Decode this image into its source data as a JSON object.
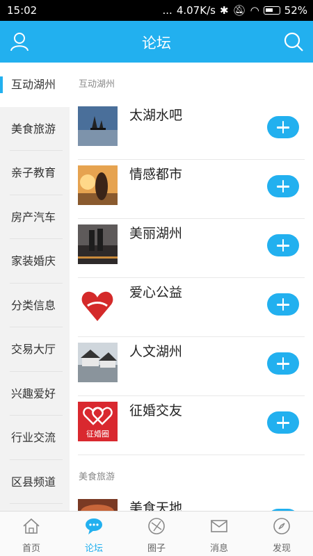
{
  "status": {
    "time": "15:02",
    "signal": "...",
    "speed": "4.07K/s",
    "battery": "52%"
  },
  "header": {
    "title": "论坛",
    "profile_icon": "user-icon",
    "search_icon": "search-icon"
  },
  "sidebar": {
    "items": [
      {
        "label": "互动湖州",
        "active": true
      },
      {
        "label": "美食旅游"
      },
      {
        "label": "亲子教育"
      },
      {
        "label": "房产汽车"
      },
      {
        "label": "家装婚庆"
      },
      {
        "label": "分类信息"
      },
      {
        "label": "交易大厅"
      },
      {
        "label": "兴趣爱好"
      },
      {
        "label": "行业交流"
      },
      {
        "label": "区县频道"
      }
    ]
  },
  "sections": [
    {
      "title": "互动湖州",
      "forums": [
        {
          "name": "太湖水吧"
        },
        {
          "name": "情感都市"
        },
        {
          "name": "美丽湖州"
        },
        {
          "name": "爱心公益"
        },
        {
          "name": "人文湖州"
        },
        {
          "name": "征婚交友",
          "logo_text": "征婚圈"
        }
      ]
    },
    {
      "title": "美食旅游",
      "forums": [
        {
          "name": "美食天地"
        }
      ]
    }
  ],
  "tabbar": {
    "tabs": [
      {
        "label": "首页",
        "icon": "home-icon"
      },
      {
        "label": "论坛",
        "icon": "chat-bubble-icon",
        "active": true
      },
      {
        "label": "圈子",
        "icon": "circle-icon"
      },
      {
        "label": "消息",
        "icon": "mail-icon"
      },
      {
        "label": "发现",
        "icon": "compass-icon"
      }
    ]
  },
  "colors": {
    "accent": "#22b0ef",
    "statusbar": "#000000",
    "sidebar_bg": "#f2f2f2"
  }
}
